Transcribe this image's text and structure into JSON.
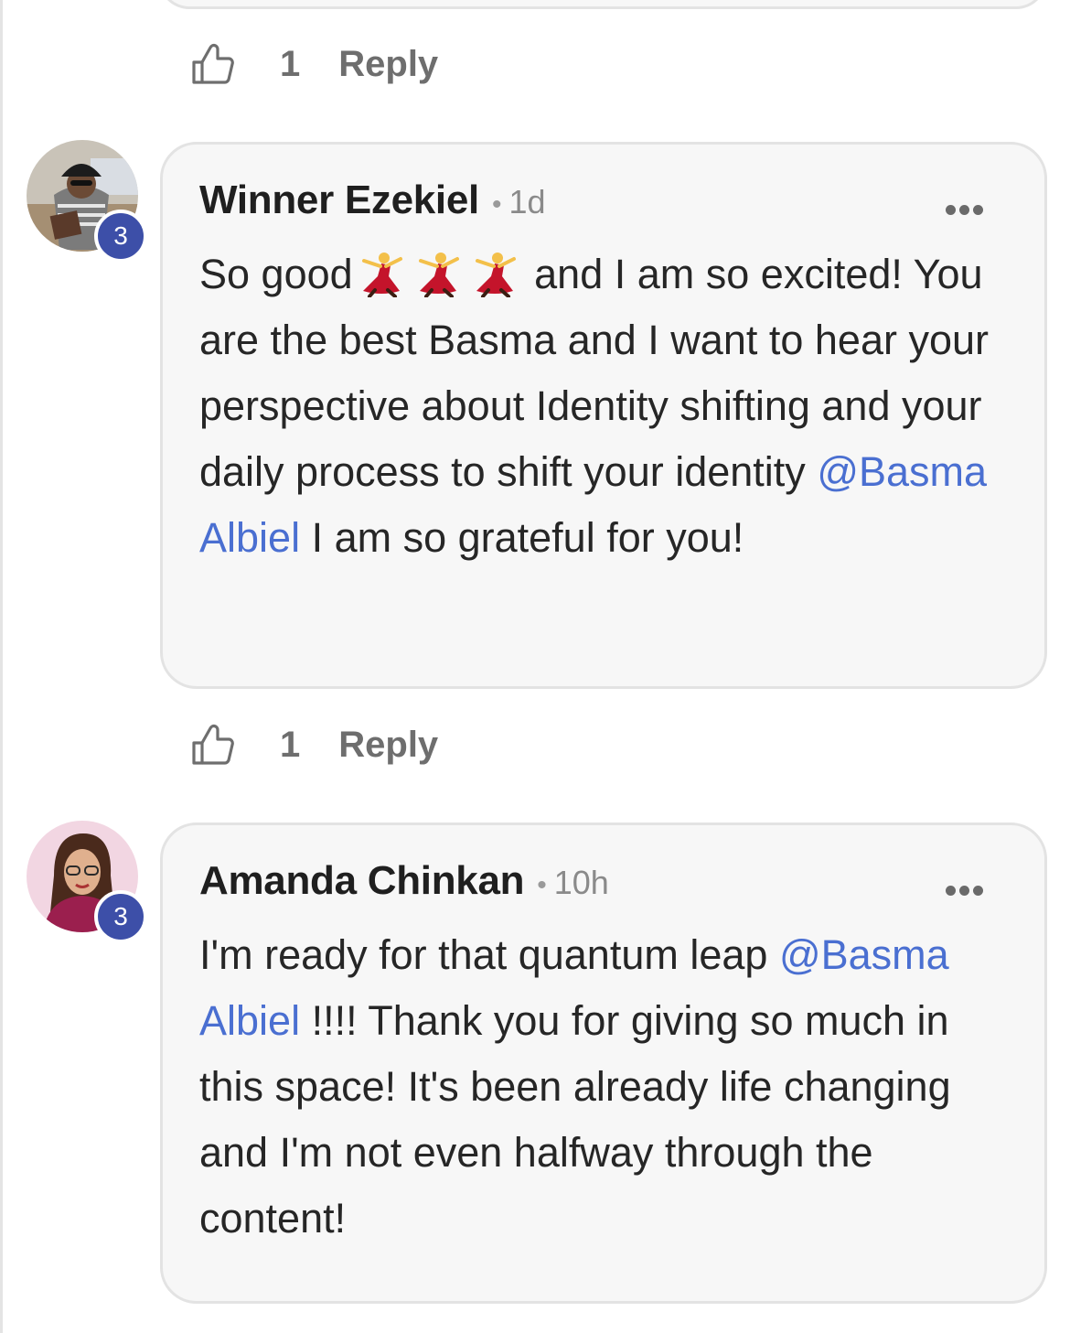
{
  "top_actions": {
    "like_count": "1",
    "reply_label": "Reply"
  },
  "comments": [
    {
      "author": "Winner Ezekiel",
      "separator": "•",
      "time": "1d",
      "level": "3",
      "text_a": "So good",
      "emojis": [
        "dancer-emoji",
        "dancer-emoji",
        "dancer-emoji"
      ],
      "text_b": " and I am so excited! You are the best Basma and I want to hear your perspective about Identity shifting and your daily process to shift your identity ",
      "mention": "@Basma Albiel",
      "text_c": " I am so grateful for you!",
      "like_count": "1",
      "reply_label": "Reply"
    },
    {
      "author": "Amanda Chinkan",
      "separator": "•",
      "time": "10h",
      "level": "3",
      "text_a": "I'm ready for that quantum leap ",
      "mention": "@Basma Albiel",
      "text_b": " !!!! Thank you for giving so much in this space! It's been already life changing and I'm not even halfway through the content!"
    }
  ],
  "colors": {
    "mention": "#4a6fd1",
    "badge": "#3d4fa8",
    "bubble_bg": "#f7f7f7",
    "bubble_border": "#e3e3e3"
  }
}
